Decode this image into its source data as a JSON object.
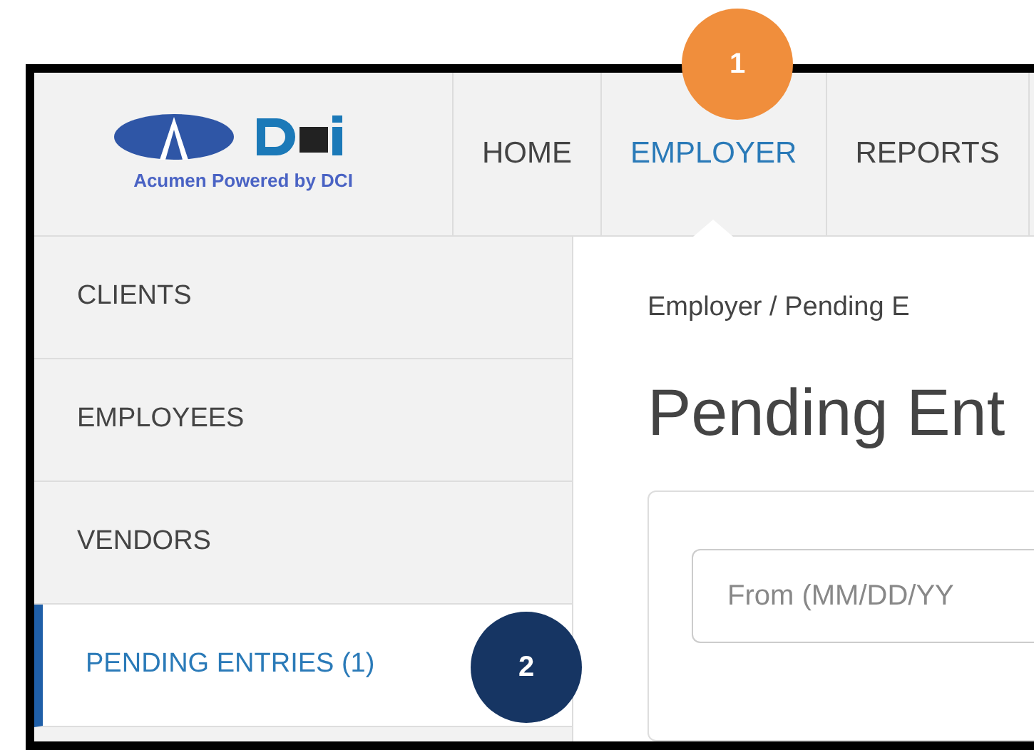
{
  "logo": {
    "tagline": "Acumen Powered by DCI"
  },
  "nav": [
    {
      "label": "HOME",
      "selected": false
    },
    {
      "label": "EMPLOYER",
      "selected": true
    },
    {
      "label": "REPORTS",
      "selected": false
    }
  ],
  "sidebar": {
    "items": [
      {
        "label": "CLIENTS",
        "selected": false
      },
      {
        "label": "EMPLOYEES",
        "selected": false
      },
      {
        "label": "VENDORS",
        "selected": false
      },
      {
        "label": "PENDING ENTRIES (1)",
        "selected": true
      }
    ]
  },
  "breadcrumb": "Employer / Pending E",
  "page_title": "Pending Ent",
  "filter": {
    "from_placeholder": "From (MM/DD/YY"
  },
  "callouts": [
    {
      "label": "1",
      "color": "#f08e3c"
    },
    {
      "label": "2",
      "color": "#163563"
    }
  ]
}
